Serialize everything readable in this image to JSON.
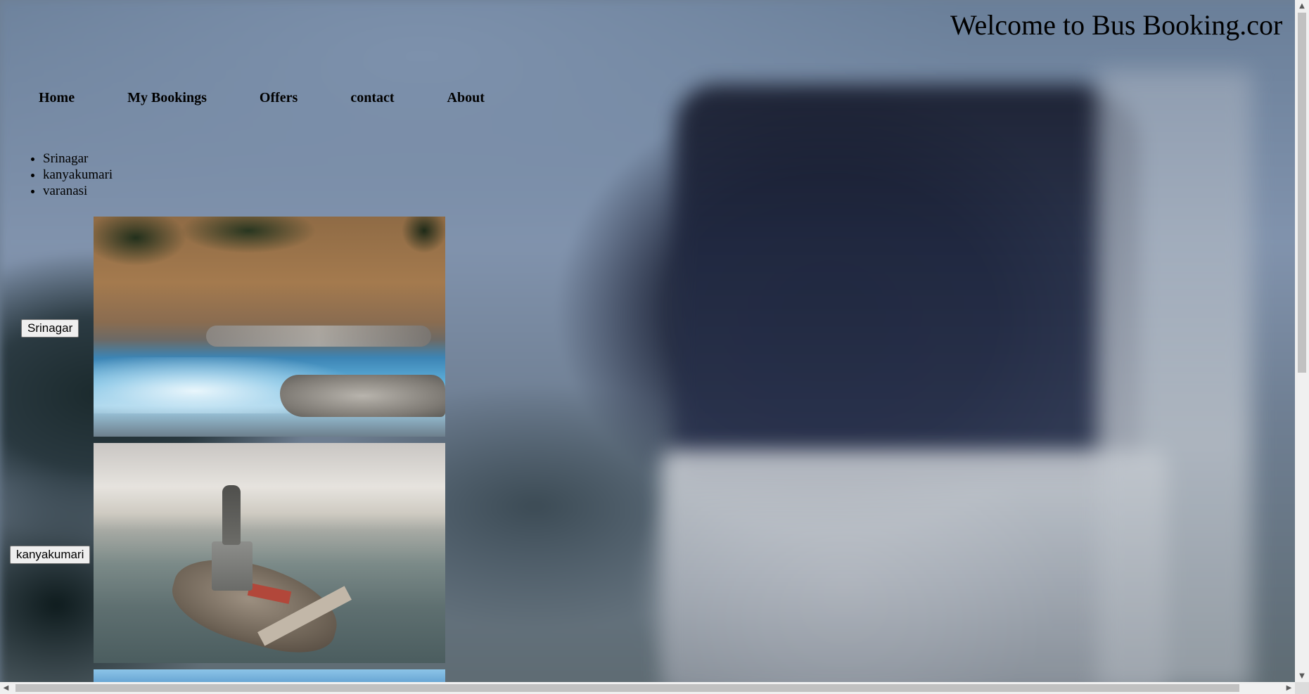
{
  "header": {
    "title": "Welcome to Bus Booking.cor"
  },
  "nav": {
    "items": [
      "Home",
      "My Bookings",
      "Offers",
      "contact",
      "About"
    ]
  },
  "destinations": {
    "list": [
      "Srinagar",
      "kanyakumari",
      "varanasi"
    ]
  },
  "gallery": {
    "buttons": [
      "Srinagar",
      "kanyakumari"
    ]
  },
  "icons": {
    "scroll_up": "▲",
    "scroll_down": "▼",
    "scroll_left": "◀",
    "scroll_right": "▶"
  }
}
